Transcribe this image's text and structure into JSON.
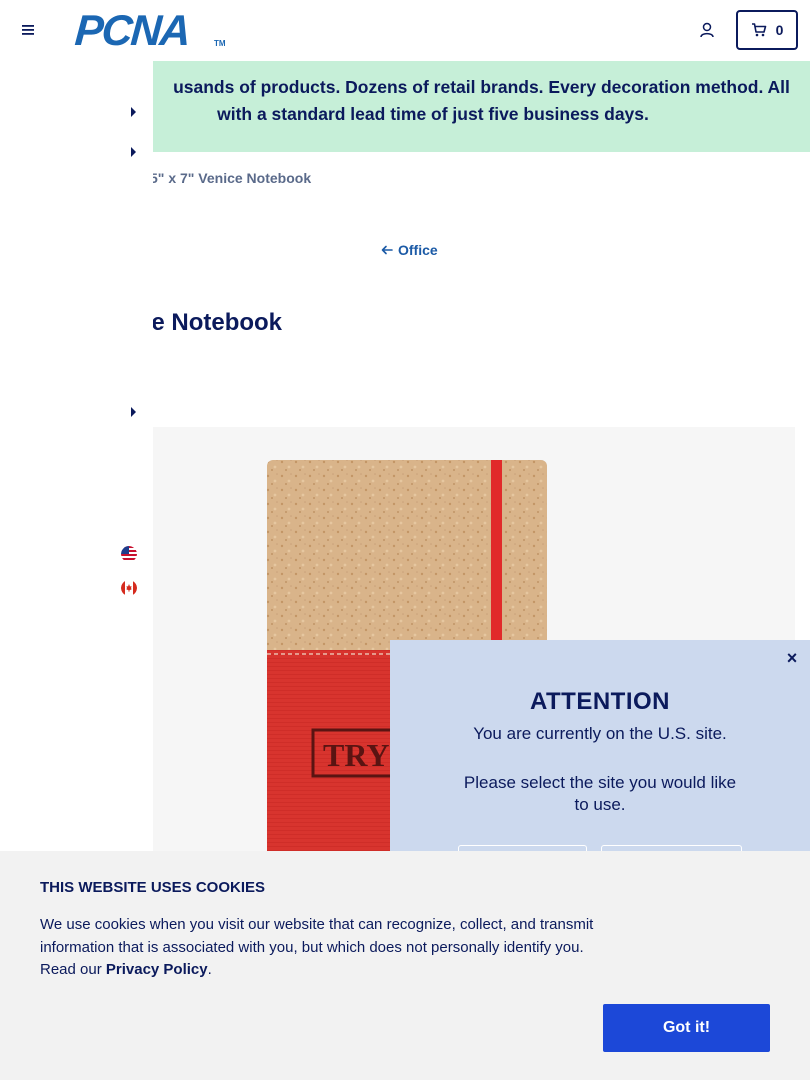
{
  "header": {
    "logo_text": "PCNA",
    "logo_tm": "TM",
    "cart_count": "0"
  },
  "banner": {
    "line1": "usands of products. Dozens of retail brands. Every decoration method. All",
    "line2": "with a standard lead time of just five business days."
  },
  "breadcrumb": "5\" x 7\" Venice Notebook",
  "back_link": "Office",
  "product_title": "ce Notebook",
  "product_imprint": "TRY",
  "attention": {
    "close": "×",
    "title": "ATTENTION",
    "subtitle": "You are currently on the U.S. site.",
    "select_text": "Please select the site you would like to use."
  },
  "cookie": {
    "title": "THIS WEBSITE USES COOKIES",
    "body": "We use cookies when you visit our website that can recognize, collect, and transmit information that is associated with you, but which does not personally identify you. Read our ",
    "link": "Privacy Policy",
    "period": ".",
    "button": "Got it!"
  },
  "colors": {
    "navy": "#0b1a5c",
    "brand_blue": "#1b67b3",
    "banner_green": "#c6efd8",
    "modal_blue": "#ccd9ee",
    "cookie_button": "#1c48d8"
  },
  "icons": [
    "menu-icon",
    "account-icon",
    "cart-icon",
    "arrow-left-icon",
    "us-flag-icon",
    "canada-flag-icon",
    "close-icon"
  ]
}
